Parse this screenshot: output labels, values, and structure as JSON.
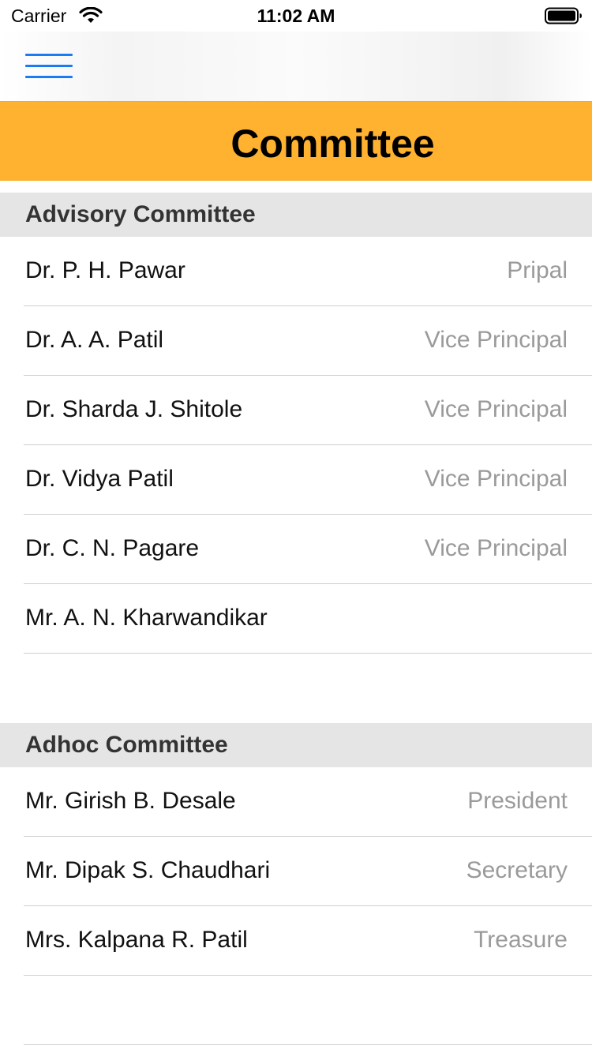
{
  "status_bar": {
    "carrier": "Carrier",
    "time": "11:02 AM",
    "wifi_icon": "wifi-icon",
    "battery_icon": "battery-icon"
  },
  "nav": {
    "menu_icon": "hamburger-menu-icon",
    "accent_color": "#1a7cf2"
  },
  "page": {
    "title": "Committee",
    "banner_color": "#ffb130"
  },
  "sections": [
    {
      "header": "Advisory Committee",
      "rows": [
        {
          "name": "Dr. P. H. Pawar",
          "role": "Pripal"
        },
        {
          "name": "Dr. A. A. Patil",
          "role": "Vice Principal"
        },
        {
          "name": "Dr. Sharda J. Shitole",
          "role": "Vice Principal"
        },
        {
          "name": "Dr. Vidya Patil",
          "role": "Vice Principal"
        },
        {
          "name": "Dr. C. N. Pagare",
          "role": "Vice Principal"
        },
        {
          "name": "Mr. A. N. Kharwandikar",
          "role": ""
        }
      ]
    },
    {
      "header": "Adhoc Committee",
      "rows": [
        {
          "name": "Mr. Girish B. Desale",
          "role": "President"
        },
        {
          "name": "Mr. Dipak S. Chaudhari",
          "role": "Secretary"
        },
        {
          "name": "Mrs. Kalpana R. Patil",
          "role": "Treasure"
        }
      ]
    }
  ]
}
